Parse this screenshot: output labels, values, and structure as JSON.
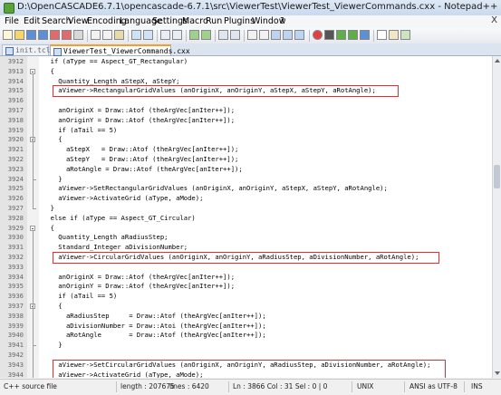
{
  "window": {
    "title": "D:\\OpenCASCADE6.7.1\\opencascade-6.7.1\\src\\ViewerTest\\ViewerTest_ViewerCommands.cxx - Notepad++"
  },
  "menu": {
    "items": [
      "File",
      "Edit",
      "Search",
      "View",
      "Encoding",
      "Language",
      "Settings",
      "Macro",
      "Run",
      "Plugins",
      "Window",
      "?"
    ],
    "close": "X"
  },
  "tabs": [
    {
      "label": "init.tcl"
    },
    {
      "label": "ViewerTest_ViewerCommands.cxx"
    }
  ],
  "editor": {
    "lines": [
      {
        "num": "3912",
        "text": "  if (aType == Aspect_GT_Rectangular)"
      },
      {
        "num": "3913",
        "text": "  {"
      },
      {
        "num": "3914",
        "text": "    Quantity_Length aStepX, aStepY;"
      },
      {
        "num": "3915",
        "text": "    aViewer->RectangularGridValues (anOriginX, anOriginY, aStepX, aStepY, aRotAngle);"
      },
      {
        "num": "3916",
        "text": ""
      },
      {
        "num": "3917",
        "text": "    anOriginX = Draw::Atof (theArgVec[anIter++]);"
      },
      {
        "num": "3918",
        "text": "    anOriginY = Draw::Atof (theArgVec[anIter++]);"
      },
      {
        "num": "3919",
        "text": "    if (aTail == 5)"
      },
      {
        "num": "3920",
        "text": "    {"
      },
      {
        "num": "3921",
        "text": "      aStepX   = Draw::Atof (theArgVec[anIter++]);"
      },
      {
        "num": "3922",
        "text": "      aStepY   = Draw::Atof (theArgVec[anIter++]);"
      },
      {
        "num": "3923",
        "text": "      aRotAngle = Draw::Atof (theArgVec[anIter++]);"
      },
      {
        "num": "3924",
        "text": "    }"
      },
      {
        "num": "3925",
        "text": "    aViewer->SetRectangularGridValues (anOriginX, anOriginY, aStepX, aStepY, aRotAngle);"
      },
      {
        "num": "3926",
        "text": "    aViewer->ActivateGrid (aType, aMode);"
      },
      {
        "num": "3927",
        "text": "  }"
      },
      {
        "num": "3928",
        "text": "  else if (aType == Aspect_GT_Circular)"
      },
      {
        "num": "3929",
        "text": "  {"
      },
      {
        "num": "3930",
        "text": "    Quantity_Length aRadiusStep;"
      },
      {
        "num": "3931",
        "text": "    Standard_Integer aDivisionNumber;"
      },
      {
        "num": "3932",
        "text": "    aViewer->CircularGridValues (anOriginX, anOriginY, aRadiusStep, aDivisionNumber, aRotAngle);"
      },
      {
        "num": "3933",
        "text": ""
      },
      {
        "num": "3934",
        "text": "    anOriginX = Draw::Atof (theArgVec[anIter++]);"
      },
      {
        "num": "3935",
        "text": "    anOriginY = Draw::Atof (theArgVec[anIter++]);"
      },
      {
        "num": "3936",
        "text": "    if (aTail == 5)"
      },
      {
        "num": "3937",
        "text": "    {"
      },
      {
        "num": "3938",
        "text": "      aRadiusStep     = Draw::Atof (theArgVec[anIter++]);"
      },
      {
        "num": "3939",
        "text": "      aDivisionNumber = Draw::Atoi (theArgVec[anIter++]);"
      },
      {
        "num": "3940",
        "text": "      aRotAngle       = Draw::Atof (theArgVec[anIter++]);"
      },
      {
        "num": "3941",
        "text": "    }"
      },
      {
        "num": "3942",
        "text": ""
      },
      {
        "num": "3943",
        "text": "    aViewer->SetCircularGridValues (anOriginX, anOriginY, aRadiusStep, aDivisionNumber, aRotAngle);"
      },
      {
        "num": "3944",
        "text": "    aViewer->ActivateGrid (aType, aMode);"
      },
      {
        "num": "3945",
        "text": "  }"
      }
    ]
  },
  "status": {
    "file_type": "C++ source file",
    "length": "length : 207675",
    "lines": "lines : 6420",
    "position": "Ln : 3866   Col : 31   Sel : 0 | 0",
    "eol": "UNIX",
    "encoding": "ANSI as UTF-8",
    "mode": "INS"
  },
  "colors": {
    "highlight_border": "#e03030",
    "active_tab_accent": "#f0a030"
  }
}
